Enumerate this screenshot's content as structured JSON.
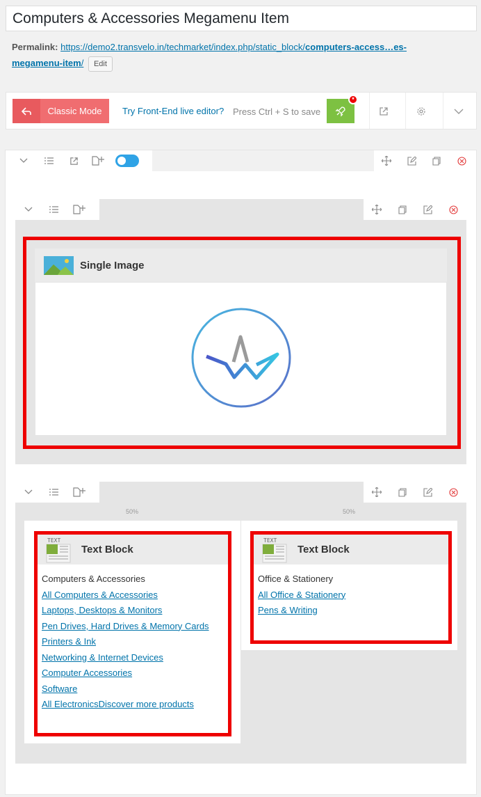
{
  "title": "Computers & Accessories Megamenu Item",
  "permalink": {
    "label": "Permalink:",
    "url_prefix": "https://demo2.transvelo.in/techmarket/index.php/static_block/",
    "url_slug_1": "computers-access…es-",
    "url_slug_2": "megamenu-item",
    "url_suffix": "/",
    "edit_label": "Edit"
  },
  "toolbar": {
    "classic_label": "Classic Mode",
    "frontend_link": "Try Front-End live editor?",
    "save_hint": "Press Ctrl + S to save",
    "badge": "*"
  },
  "row1": {
    "element": {
      "title": "Single Image",
      "icon": "image-icon"
    }
  },
  "row2": {
    "col1": {
      "width_label": "50%",
      "element_title": "Text Block",
      "icon_text": "TEXT",
      "heading": "Computers & Accessories",
      "links": [
        "All Computers & Accessories",
        "Laptops, Desktops & Monitors",
        "Pen Drives, Hard Drives & Memory Cards",
        "Printers & Ink",
        "Networking & Internet Devices",
        "Computer Accessories",
        "Software",
        "All ElectronicsDiscover more products"
      ]
    },
    "col2": {
      "width_label": "50%",
      "element_title": "Text Block",
      "icon_text": "TEXT",
      "heading": "Office & Stationery",
      "links": [
        "All Office & Stationery",
        "Pens & Writing"
      ]
    }
  },
  "colors": {
    "highlight": "#ee0000",
    "classic": "#f06d70",
    "publish": "#7dc142",
    "link": "#0073aa",
    "toggle": "#2fa3e6"
  }
}
